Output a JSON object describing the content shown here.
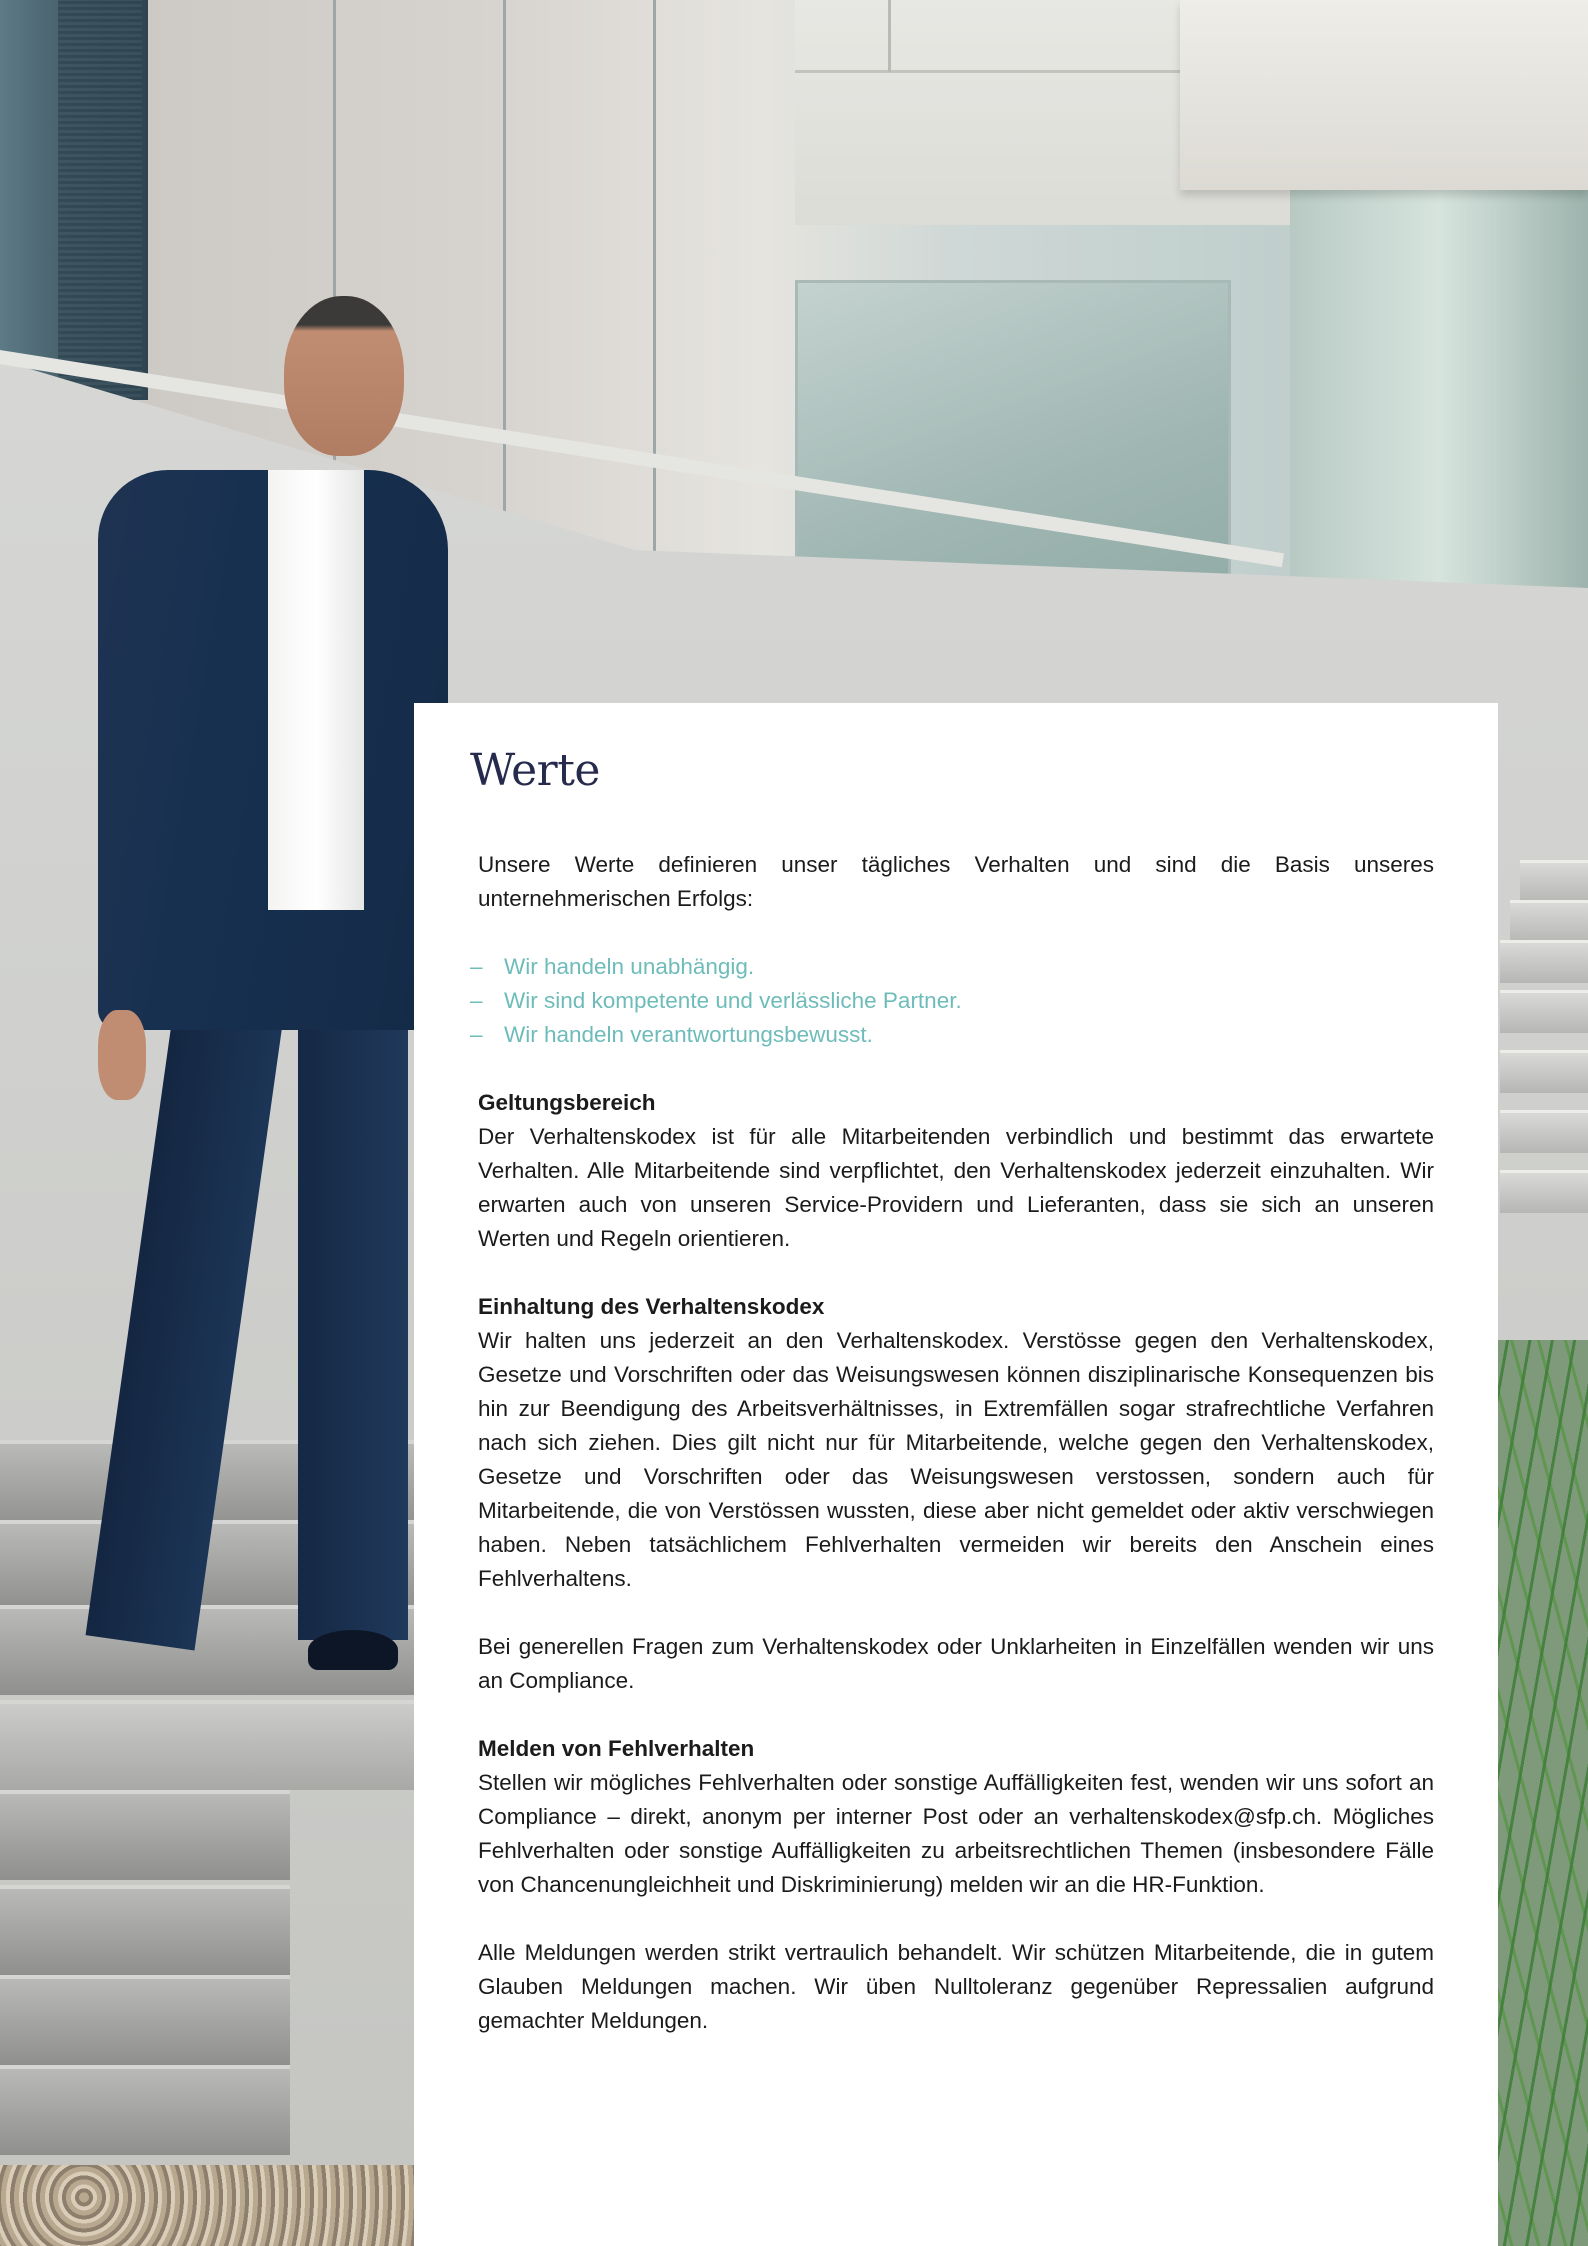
{
  "page": {
    "title": "Werte",
    "accent_color": "#6ebcba",
    "title_color": "#262b4d"
  },
  "intro": "Unsere Werte definieren unser tägliches Verhalten und sind die Basis unseres unternehmerischen Erfolgs:",
  "values": [
    {
      "dash": "–",
      "text": "Wir handeln unabhängig."
    },
    {
      "dash": "–",
      "text": "Wir sind kompetente und verlässliche Partner."
    },
    {
      "dash": "–",
      "text": "Wir handeln verantwortungsbewusst."
    }
  ],
  "sections": {
    "scope": {
      "heading": "Geltungsbereich",
      "body": "Der Verhaltenskodex ist für alle Mitarbeitenden verbindlich und bestimmt das erwartete Verhalten. Alle Mitarbeitende sind verpflichtet, den Verhaltenskodex jederzeit einzuhalten. Wir erwarten auch von unseren Service-Providern und Lieferanten, dass sie sich an unseren Werten und Regeln orientieren."
    },
    "compliance": {
      "heading": "Einhaltung des Verhaltenskodex",
      "body": "Wir halten uns jederzeit an den Verhaltenskodex. Verstösse gegen den Verhaltenskodex, Gesetze und Vorschriften oder das Weisungswesen können disziplinarische Konsequenzen bis hin zur Beendigung des Arbeitsverhältnisses, in Extremfällen sogar strafrechtliche Verfahren nach sich ziehen. Dies gilt nicht nur für Mitarbeitende, welche gegen den Verhaltenskodex, Gesetze und Vorschriften oder das Weisungswesen verstossen, sondern auch für Mitarbeitende, die von Verstössen wussten, diese aber nicht gemeldet oder aktiv verschwiegen haben. Neben tatsächlichem Fehlverhalten vermeiden wir bereits den Anschein eines Fehlverhaltens.",
      "note": "Bei generellen Fragen zum Verhaltenskodex oder Unklarheiten in Einzelfällen wenden wir uns an Compliance."
    },
    "reporting": {
      "heading": "Melden von Fehlverhalten",
      "body": "Stellen wir mögliches Fehlverhalten oder sonstige Auffälligkeiten fest, wenden wir uns sofort an Compliance – direkt, anonym per interner Post oder an verhaltenskodex@sfp.ch. Mögliches Fehlverhalten oder sonstige Auffälligkeiten zu arbeitsrechtlichen Themen (insbesondere Fälle von Chancenungleichheit und Diskriminierung) melden wir an die HR-Funktion.",
      "confidentiality": "Alle Meldungen werden strikt vertraulich behandelt. Wir schützen Mitarbeitende, die in gutem Glauben Meldungen machen. Wir üben Nulltoleranz gegenüber Repressalien aufgrund gemachter Meldungen."
    }
  }
}
